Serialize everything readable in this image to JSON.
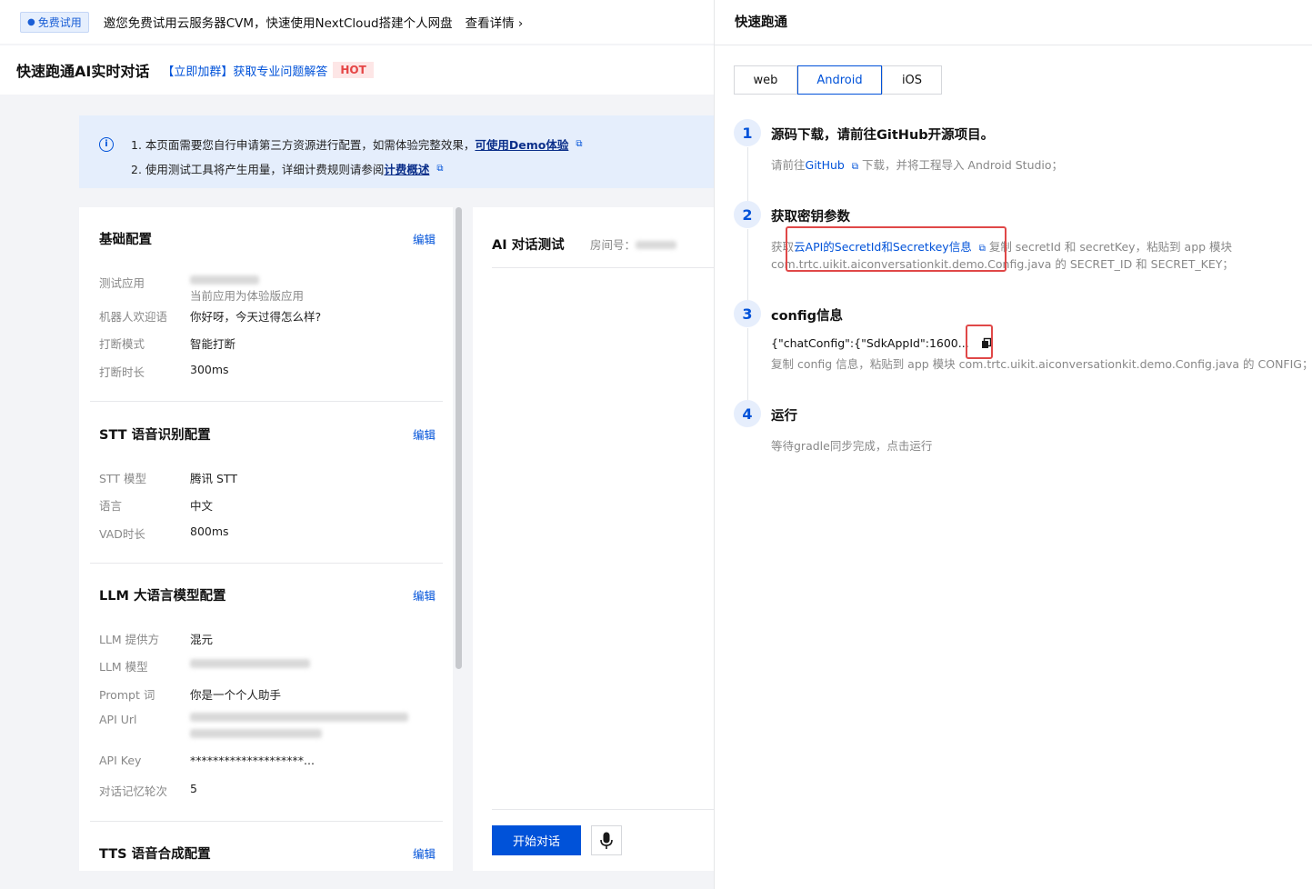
{
  "promo": {
    "badge": "免费试用",
    "text": "邀您免费试用云服务器CVM，快速使用NextCloud搭建个人网盘",
    "link": "查看详情"
  },
  "header": {
    "title": "快速跑通AI实时对话",
    "join_link": "【立即加群】获取专业问题解答",
    "hot": "HOT"
  },
  "notice": {
    "line1_text": "1. 本页面需要您自行申请第三方资源进行配置，如需体验完整效果，",
    "line1_link": "可使用Demo体验",
    "line2_text": "2. 使用测试工具将产生用量，详细计费规则请参阅",
    "line2_link": "计费概述"
  },
  "config": {
    "edit_label": "编辑",
    "basic": {
      "title": "基础配置",
      "app_label": "测试应用",
      "app_sub": "当前应用为体验版应用",
      "welcome_label": "机器人欢迎语",
      "welcome_value": "你好呀，今天过得怎么样?",
      "interrupt_label": "打断模式",
      "interrupt_value": "智能打断",
      "duration_label": "打断时长",
      "duration_value": "300ms"
    },
    "stt": {
      "title": "STT 语音识别配置",
      "model_label": "STT 模型",
      "model_value": "腾讯 STT",
      "lang_label": "语言",
      "lang_value": "中文",
      "vad_label": "VAD时长",
      "vad_value": "800ms"
    },
    "llm": {
      "title": "LLM 大语言模型配置",
      "provider_label": "LLM 提供方",
      "provider_value": "混元",
      "model_label": "LLM 模型",
      "prompt_label": "Prompt 词",
      "prompt_value": "你是一个个人助手",
      "url_label": "API Url",
      "key_label": "API Key",
      "key_value": "********************...",
      "memory_label": "对话记忆轮次",
      "memory_value": "5"
    },
    "tts": {
      "title": "TTS 语音合成配置"
    }
  },
  "chat": {
    "title": "AI 对话测试",
    "room_label": "房间号：",
    "start_button": "开始对话"
  },
  "drawer": {
    "title": "快速跑通",
    "tabs": [
      "web",
      "Android",
      "iOS"
    ],
    "active_tab": "Android",
    "step1": {
      "num": "1",
      "title": "源码下载，请前往GitHub开源项目。",
      "prefix": "请前往",
      "link": "GitHub",
      "suffix": "下载，并将工程导入 Android Studio；"
    },
    "step2": {
      "num": "2",
      "title": "获取密钥参数",
      "prefix": "获取",
      "link": "云API的SecretId和Secretkey信息",
      "suffix": "复制 secretId 和 secretKey，粘贴到 app 模块",
      "line2": "com.trtc.uikit.aiconversationkit.demo.Config.java 的 SECRET_ID 和 SECRET_KEY；"
    },
    "step3": {
      "num": "3",
      "title": "config信息",
      "config_value": "{\"chatConfig\":{\"SdkAppId\":1600...",
      "desc": "复制 config 信息，粘贴到 app 模块 com.trtc.uikit.aiconversationkit.demo.Config.java 的 CONFIG；"
    },
    "step4": {
      "num": "4",
      "title": "运行",
      "desc": "等待gradle同步完成，点击运行"
    }
  }
}
